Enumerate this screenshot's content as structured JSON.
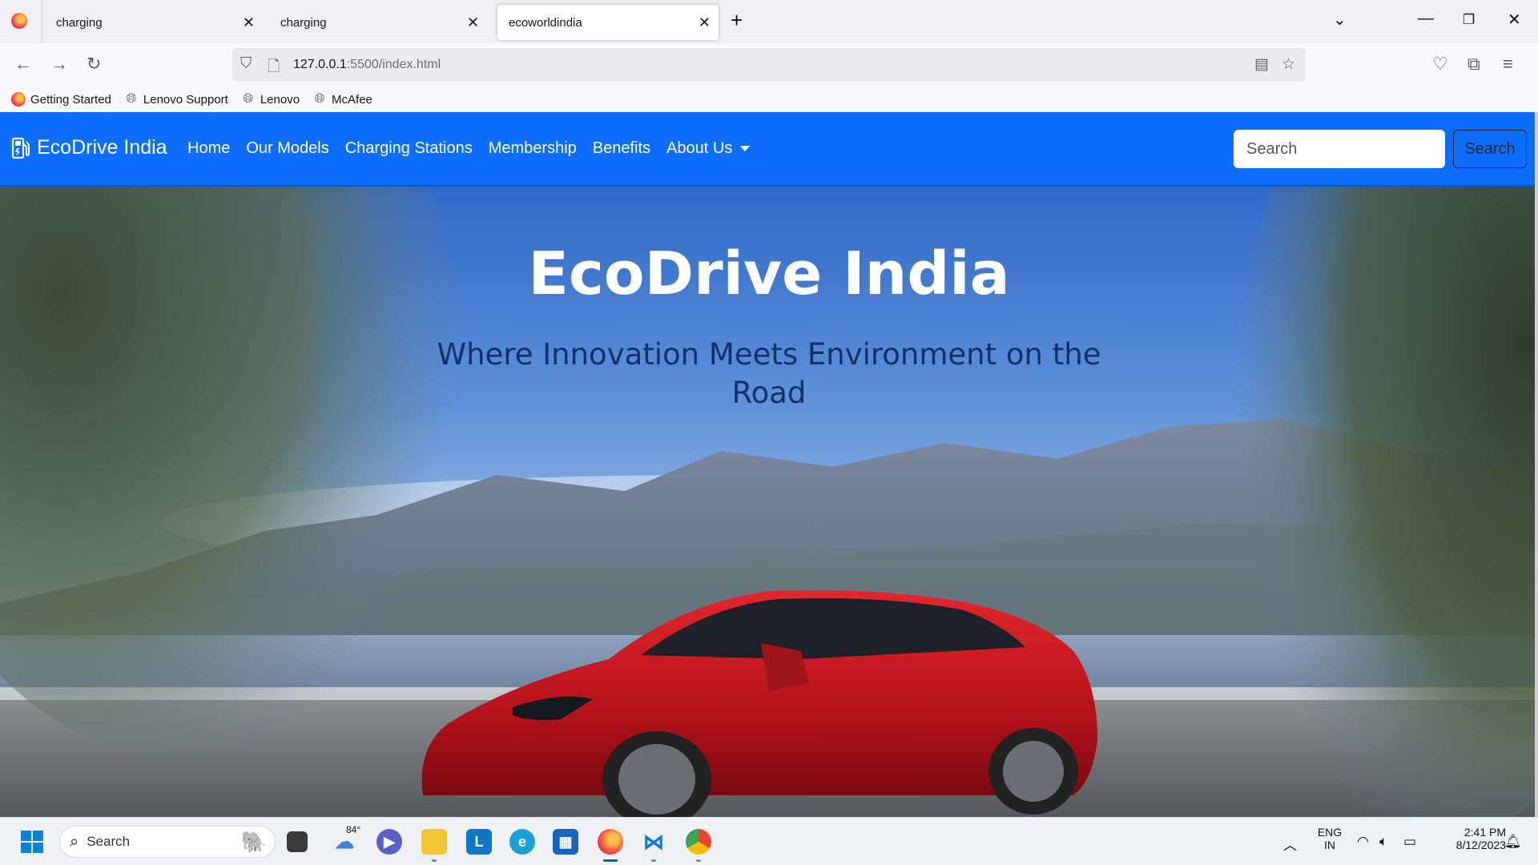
{
  "browser": {
    "tabs": [
      {
        "label": "charging",
        "active": false
      },
      {
        "label": "charging",
        "active": false
      },
      {
        "label": "ecoworldindia",
        "active": true
      }
    ],
    "url_host": "127.0.0.1",
    "url_path": ":5500/index.html",
    "bookmarks": [
      "Getting Started",
      "Lenovo Support",
      "Lenovo",
      "McAfee"
    ]
  },
  "site": {
    "brand": "EcoDrive India",
    "nav": [
      "Home",
      "Our Models",
      "Charging Stations",
      "Membership",
      "Benefits",
      "About Us"
    ],
    "search_placeholder": "Search",
    "search_button": "Search",
    "hero_title": "EcoDrive India",
    "hero_subtitle": "Where Innovation Meets Environment on the Road"
  },
  "taskbar": {
    "search_label": "Search",
    "weather_temp": "84°",
    "language": "ENG",
    "region": "IN",
    "time": "2:41 PM",
    "date": "8/12/2023"
  },
  "colors": {
    "navbar": "#0d6efd",
    "car": "#c8151b"
  }
}
